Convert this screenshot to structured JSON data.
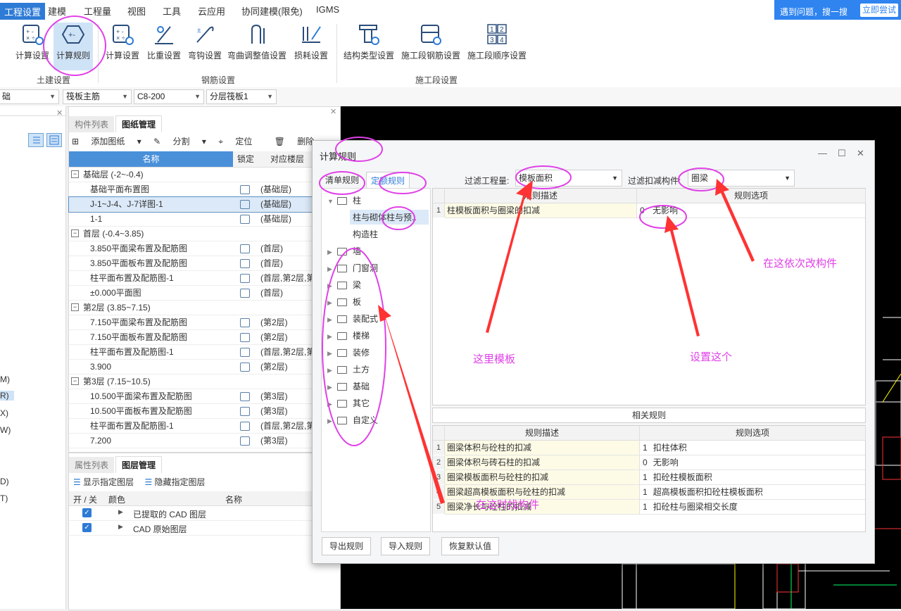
{
  "menubar": {
    "items": [
      "工程设置",
      "建模",
      "工程量",
      "视图",
      "工具",
      "云应用",
      "协同建模(限免)",
      "IGMS"
    ],
    "help_text": "遇到问题，搜一搜",
    "help_button": "立即尝试"
  },
  "ribbon": {
    "buttons": [
      "计算设置",
      "计算规则",
      "计算设置",
      "比重设置",
      "弯钩设置",
      "弯曲调整值设置",
      "损耗设置",
      "结构类型设置",
      "施工段钢筋设置",
      "施工段顺序设置"
    ],
    "groups": [
      "土建设置",
      "钢筋设置",
      "施工段设置"
    ]
  },
  "combos": [
    "础",
    "筏板主筋",
    "C8-200",
    "分层筏板1"
  ],
  "leftstrip": {
    "letters": [
      "M)",
      "R)",
      "X)",
      "W)",
      "D)",
      "T)"
    ]
  },
  "drawing_panel": {
    "tabs": [
      "构件列表",
      "图纸管理"
    ],
    "toolbar": [
      "添加图纸",
      "分割",
      "定位",
      "删除"
    ],
    "headers": [
      "名称",
      "锁定",
      "对应楼层"
    ],
    "rows": [
      {
        "name": "基础层 (-2~-0.4)",
        "floor": ""
      },
      {
        "name": "基础平面布置图",
        "floor": "(基础层)"
      },
      {
        "name": "J-1~J-4、J-7详图-1",
        "floor": "(基础层)"
      },
      {
        "name": "1-1",
        "floor": "(基础层)"
      },
      {
        "name": "首层 (-0.4~3.85)",
        "floor": ""
      },
      {
        "name": "3.850平面梁布置及配筋图",
        "floor": "(首层)"
      },
      {
        "name": "3.850平面板布置及配筋图",
        "floor": "(首层)"
      },
      {
        "name": "柱平面布置及配筋图-1",
        "floor": "(首层,第2层,第"
      },
      {
        "name": "±0.000平面图",
        "floor": "(首层)"
      },
      {
        "name": "第2层 (3.85~7.15)",
        "floor": ""
      },
      {
        "name": "7.150平面梁布置及配筋图",
        "floor": "(第2层)"
      },
      {
        "name": "7.150平面板布置及配筋图",
        "floor": "(第2层)"
      },
      {
        "name": "柱平面布置及配筋图-1",
        "floor": "(首层,第2层,第"
      },
      {
        "name": "3.900",
        "floor": "(第2层)"
      },
      {
        "name": "第3层 (7.15~10.5)",
        "floor": ""
      },
      {
        "name": "10.500平面梁布置及配筋图",
        "floor": "(第3层)"
      },
      {
        "name": "10.500平面板布置及配筋图",
        "floor": "(第3层)"
      },
      {
        "name": "柱平面布置及配筋图-1",
        "floor": "(首层,第2层,第"
      },
      {
        "name": "7.200",
        "floor": "(第3层)"
      }
    ]
  },
  "layer_panel": {
    "tabs": [
      "属性列表",
      "图层管理"
    ],
    "toolbar": [
      "显示指定图层",
      "隐藏指定图层"
    ],
    "headers": [
      "开 / 关",
      "颜色",
      "名称"
    ],
    "rows": [
      "已提取的 CAD 图层",
      "CAD 原始图层"
    ]
  },
  "dialog": {
    "title": "计算规则",
    "tabs": [
      "清单规则",
      "定额规则"
    ],
    "filter_label": "过滤工程量:",
    "filter_value": "模板面积",
    "filter2_label": "过滤扣减构件:",
    "filter2_value": "圈梁",
    "tree": {
      "root": "柱",
      "children": [
        "柱与砌体柱与预..",
        "构造柱"
      ],
      "folders": [
        "墙",
        "门窗洞",
        "梁",
        "板",
        "装配式",
        "楼梯",
        "装修",
        "土方",
        "基础",
        "其它",
        "自定义"
      ]
    },
    "main_table": {
      "headers": [
        "规则描述",
        "规则选项"
      ],
      "rows": [
        {
          "num": "1",
          "desc": "柱模板面积与圈梁的扣减",
          "opt_num": "0",
          "opt": "无影响"
        }
      ]
    },
    "related_label": "相关规则",
    "related_table": {
      "headers": [
        "规则描述",
        "规则选项"
      ],
      "rows": [
        {
          "num": "1",
          "desc": "圈梁体积与砼柱的扣减",
          "opt_num": "1",
          "opt": "扣柱体积"
        },
        {
          "num": "2",
          "desc": "圈梁体积与砖石柱的扣减",
          "opt_num": "0",
          "opt": "无影响"
        },
        {
          "num": "3",
          "desc": "圈梁模板面积与砼柱的扣减",
          "opt_num": "1",
          "opt": "扣砼柱模板面积"
        },
        {
          "num": "4",
          "desc": "圈梁超高模板面积与砼柱的扣减",
          "opt_num": "1",
          "opt": "超高模板面积扣砼柱模板面积"
        },
        {
          "num": "5",
          "desc": "圈梁净长与砼柱的扣减",
          "opt_num": "1",
          "opt": "扣砼柱与圈梁相交长度"
        }
      ]
    },
    "buttons": [
      "导出规则",
      "导入规则",
      "恢复默认值"
    ]
  },
  "annotations": {
    "change_component": "在这依次改构件",
    "template_here": "这里模板",
    "set_this": "设置这个",
    "click_component": "在这时找构件"
  },
  "colors": {
    "accent": "#2e7bd6",
    "annotation": "#e040e8",
    "arrow": "#ff3333"
  }
}
